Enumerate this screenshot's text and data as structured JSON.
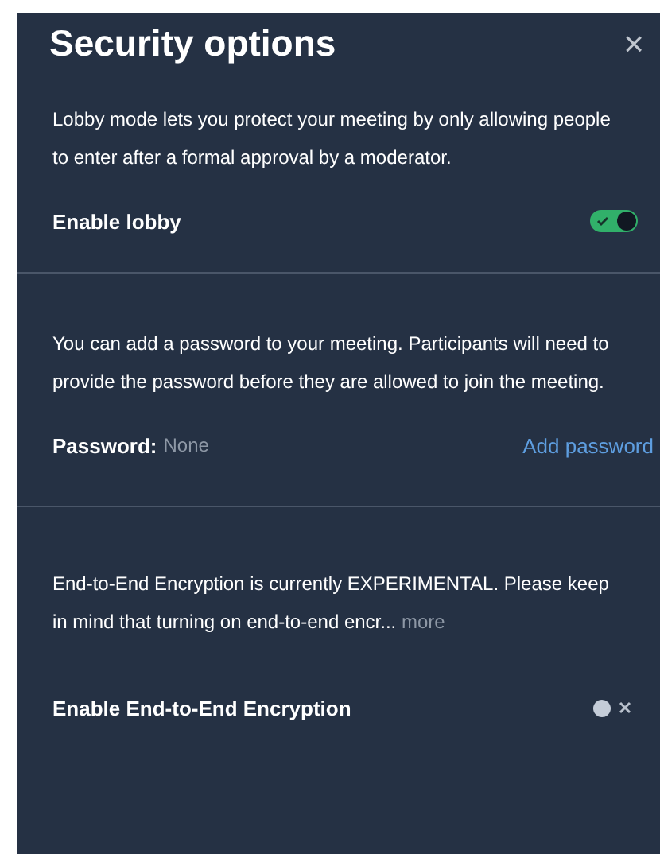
{
  "dialog": {
    "title": "Security options",
    "close": "×"
  },
  "lobby": {
    "description": "Lobby mode lets you protect your meeting by only allowing people to enter after a formal approval by a moderator.",
    "label": "Enable lobby",
    "on": true
  },
  "password": {
    "description": "You can add a password to your meeting. Participants will need to provide the password before they are allowed to join the meeting.",
    "label": "Password:",
    "value": "None",
    "action": "Add password"
  },
  "e2ee": {
    "description": "End-to-End Encryption is currently EXPERIMENTAL. Please keep in mind that turning on end-to-end encr...",
    "more": "more",
    "label": "Enable End-to-End Encryption",
    "on": false
  }
}
